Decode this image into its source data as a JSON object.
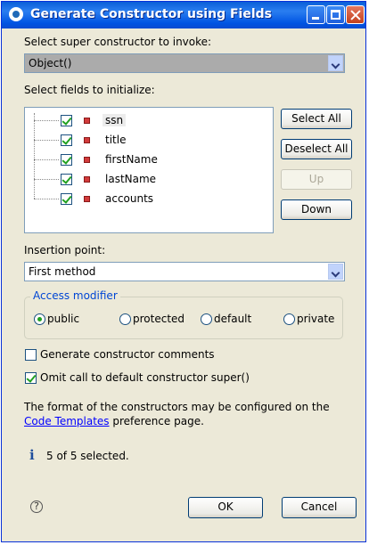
{
  "window": {
    "title": "Generate Constructor using Fields"
  },
  "super_constructor": {
    "label": "Select super constructor to invoke:",
    "selected": "Object()"
  },
  "fields": {
    "label": "Select fields to initialize:",
    "items": [
      {
        "name": "ssn",
        "checked": true
      },
      {
        "name": "title",
        "checked": true
      },
      {
        "name": "firstName",
        "checked": true
      },
      {
        "name": "lastName",
        "checked": true
      },
      {
        "name": "accounts",
        "checked": true
      }
    ]
  },
  "side_buttons": {
    "select_all": "Select All",
    "deselect_all": "Deselect All",
    "up": "Up",
    "down": "Down"
  },
  "insertion_point": {
    "label": "Insertion point:",
    "selected": "First method"
  },
  "access_modifier": {
    "label": "Access modifier",
    "options": [
      "public",
      "protected",
      "default",
      "private"
    ],
    "selected": "public"
  },
  "options": {
    "generate_comments": {
      "label": "Generate constructor comments",
      "checked": false
    },
    "omit_super": {
      "label": "Omit call to default constructor super()",
      "checked": true
    }
  },
  "info": {
    "text_before": "The format of the constructors may be configured on the",
    "link": "Code Templates",
    "text_after": "preference page."
  },
  "status": {
    "text": "5 of 5 selected."
  },
  "footer": {
    "ok": "OK",
    "cancel": "Cancel"
  },
  "colors": {
    "titlebar": "#0054e3",
    "dialog_bg": "#ece9d8",
    "check": "#21a121",
    "link": "#0000ff"
  }
}
